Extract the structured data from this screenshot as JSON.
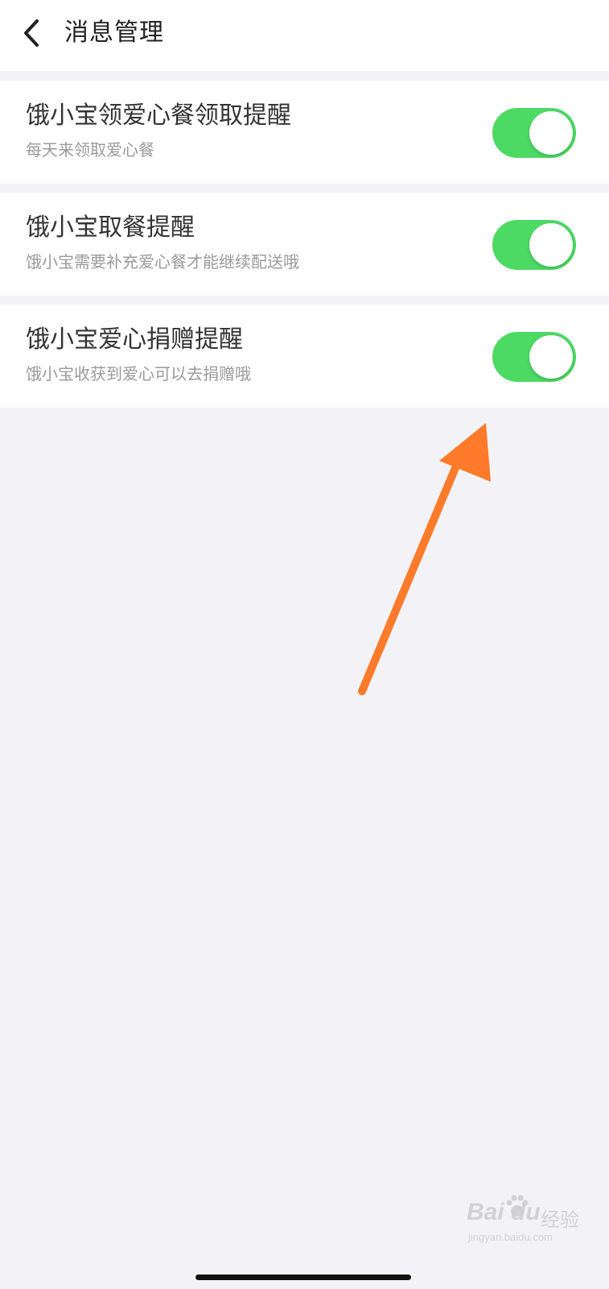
{
  "header": {
    "back_icon": "chevron-left-icon",
    "title": "消息管理"
  },
  "settings": [
    {
      "title": "饿小宝领爱心餐领取提醒",
      "subtitle": "每天来领取爱心餐",
      "enabled": true
    },
    {
      "title": "饿小宝取餐提醒",
      "subtitle": "饿小宝需要补充爱心餐才能继续配送哦",
      "enabled": true
    },
    {
      "title": "饿小宝爱心捐赠提醒",
      "subtitle": "饿小宝收获到爱心可以去捐赠哦",
      "enabled": true
    }
  ],
  "annotation": {
    "icon": "arrow-icon",
    "color": "#ff7a2a"
  },
  "watermark": {
    "brand": "Bai  du",
    "cn": "经验",
    "url": "jingyan.baidu.com"
  },
  "colors": {
    "toggle_on": "#4cd964",
    "background": "#f3f3f7"
  }
}
